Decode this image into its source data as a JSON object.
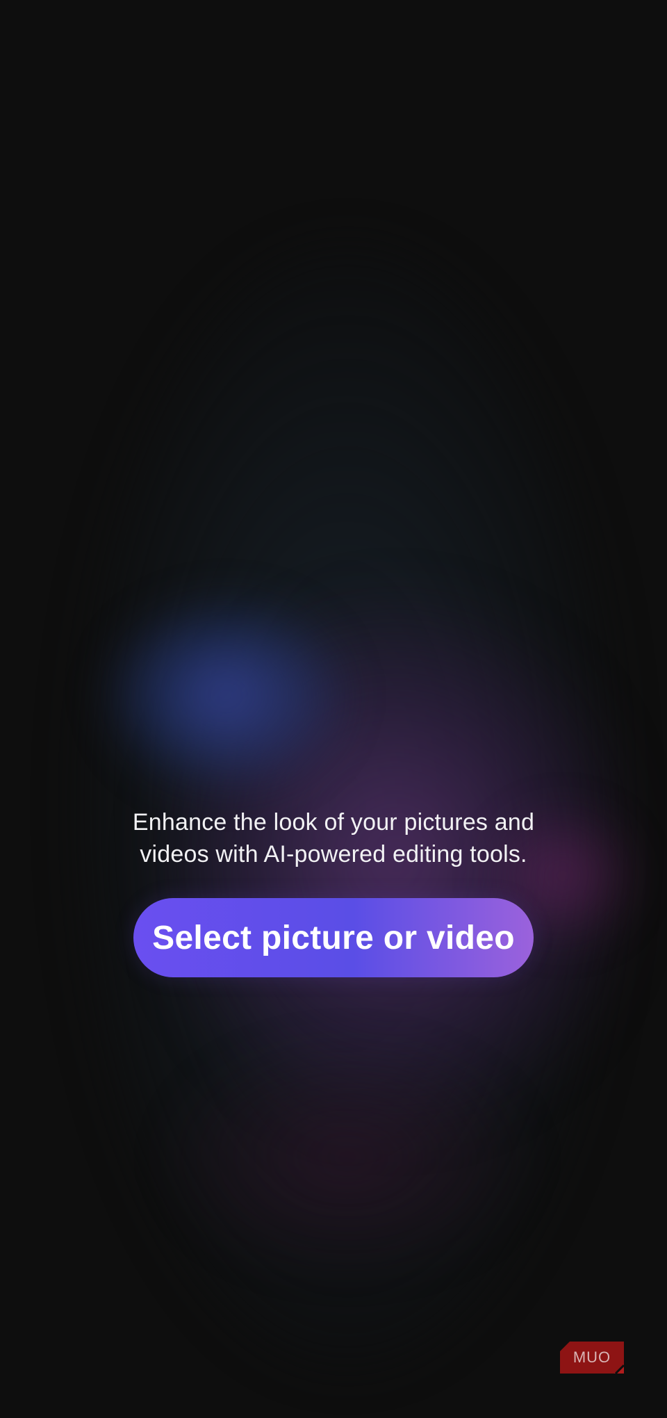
{
  "main": {
    "description": "Enhance the look of your pictures and videos with AI-powered editing tools.",
    "select_button_label": "Select picture or video"
  },
  "watermark": {
    "text": "MUO"
  },
  "colors": {
    "background": "#0e0e0e",
    "button_gradient_start": "#6a4ff0",
    "button_gradient_end": "#9b62dc",
    "watermark_red": "#8e1414"
  }
}
